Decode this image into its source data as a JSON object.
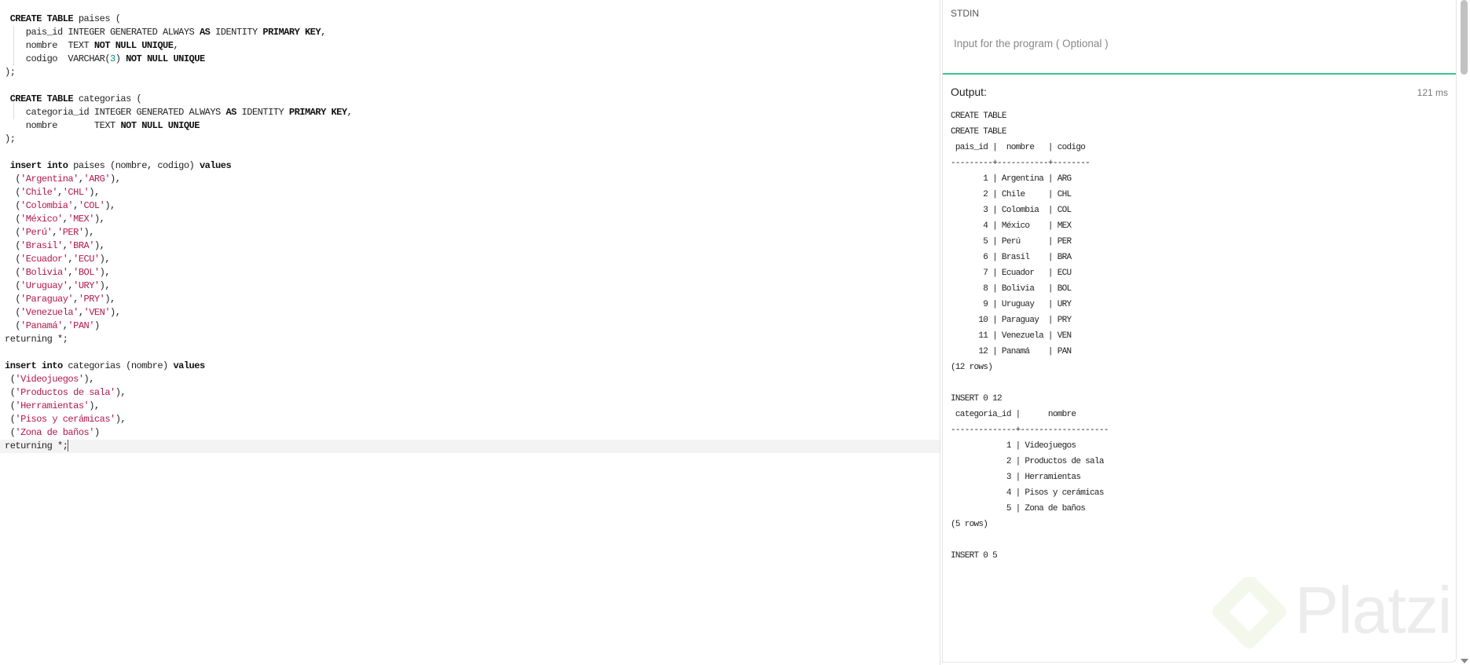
{
  "editor": {
    "lines": [
      [
        [
          " CREATE TABLE",
          "k"
        ],
        [
          " paises (",
          "p"
        ]
      ],
      [
        [
          "    pais_id INTEGER GENERATED ALWAYS ",
          "p"
        ],
        [
          "AS",
          "k"
        ],
        [
          " IDENTITY ",
          "p"
        ],
        [
          "PRIMARY KEY",
          "k"
        ],
        [
          ",",
          "p"
        ]
      ],
      [
        [
          "    nombre  TEXT ",
          "p"
        ],
        [
          "NOT NULL UNIQUE",
          "k"
        ],
        [
          ",",
          "p"
        ]
      ],
      [
        [
          "    codigo  VARCHAR(",
          "p"
        ],
        [
          "3",
          "n"
        ],
        [
          ") ",
          "p"
        ],
        [
          "NOT NULL UNIQUE",
          "k"
        ]
      ],
      [
        [
          ");",
          "p"
        ]
      ],
      [
        [
          "",
          "p"
        ]
      ],
      [
        [
          " CREATE TABLE",
          "k"
        ],
        [
          " categorias (",
          "p"
        ]
      ],
      [
        [
          "    categoria_id INTEGER GENERATED ALWAYS ",
          "p"
        ],
        [
          "AS",
          "k"
        ],
        [
          " IDENTITY ",
          "p"
        ],
        [
          "PRIMARY KEY",
          "k"
        ],
        [
          ",",
          "p"
        ]
      ],
      [
        [
          "    nombre       TEXT ",
          "p"
        ],
        [
          "NOT NULL UNIQUE",
          "k"
        ]
      ],
      [
        [
          ");",
          "p"
        ]
      ],
      [
        [
          "",
          "p"
        ]
      ],
      [
        [
          " insert into",
          "k"
        ],
        [
          " paises (nombre, codigo) ",
          "p"
        ],
        [
          "values",
          "k"
        ]
      ],
      [
        [
          "  (",
          "p"
        ],
        [
          "'Argentina'",
          "s"
        ],
        [
          ",",
          "p"
        ],
        [
          "'ARG'",
          "s"
        ],
        [
          "),",
          "p"
        ]
      ],
      [
        [
          "  (",
          "p"
        ],
        [
          "'Chile'",
          "s"
        ],
        [
          ",",
          "p"
        ],
        [
          "'CHL'",
          "s"
        ],
        [
          "),",
          "p"
        ]
      ],
      [
        [
          "  (",
          "p"
        ],
        [
          "'Colombia'",
          "s"
        ],
        [
          ",",
          "p"
        ],
        [
          "'COL'",
          "s"
        ],
        [
          "),",
          "p"
        ]
      ],
      [
        [
          "  (",
          "p"
        ],
        [
          "'México'",
          "s"
        ],
        [
          ",",
          "p"
        ],
        [
          "'MEX'",
          "s"
        ],
        [
          "),",
          "p"
        ]
      ],
      [
        [
          "  (",
          "p"
        ],
        [
          "'Perú'",
          "s"
        ],
        [
          ",",
          "p"
        ],
        [
          "'PER'",
          "s"
        ],
        [
          "),",
          "p"
        ]
      ],
      [
        [
          "  (",
          "p"
        ],
        [
          "'Brasil'",
          "s"
        ],
        [
          ",",
          "p"
        ],
        [
          "'BRA'",
          "s"
        ],
        [
          "),",
          "p"
        ]
      ],
      [
        [
          "  (",
          "p"
        ],
        [
          "'Ecuador'",
          "s"
        ],
        [
          ",",
          "p"
        ],
        [
          "'ECU'",
          "s"
        ],
        [
          "),",
          "p"
        ]
      ],
      [
        [
          "  (",
          "p"
        ],
        [
          "'Bolivia'",
          "s"
        ],
        [
          ",",
          "p"
        ],
        [
          "'BOL'",
          "s"
        ],
        [
          "),",
          "p"
        ]
      ],
      [
        [
          "  (",
          "p"
        ],
        [
          "'Uruguay'",
          "s"
        ],
        [
          ",",
          "p"
        ],
        [
          "'URY'",
          "s"
        ],
        [
          "),",
          "p"
        ]
      ],
      [
        [
          "  (",
          "p"
        ],
        [
          "'Paraguay'",
          "s"
        ],
        [
          ",",
          "p"
        ],
        [
          "'PRY'",
          "s"
        ],
        [
          "),",
          "p"
        ]
      ],
      [
        [
          "  (",
          "p"
        ],
        [
          "'Venezuela'",
          "s"
        ],
        [
          ",",
          "p"
        ],
        [
          "'VEN'",
          "s"
        ],
        [
          "),",
          "p"
        ]
      ],
      [
        [
          "  (",
          "p"
        ],
        [
          "'Panamá'",
          "s"
        ],
        [
          ",",
          "p"
        ],
        [
          "'PAN'",
          "s"
        ],
        [
          ")",
          "p"
        ]
      ],
      [
        [
          "returning *;",
          "p"
        ]
      ],
      [
        [
          "",
          "p"
        ]
      ],
      [
        [
          "insert into",
          "k"
        ],
        [
          " categorias (nombre) ",
          "p"
        ],
        [
          "values",
          "k"
        ]
      ],
      [
        [
          " (",
          "p"
        ],
        [
          "'Videojuegos'",
          "s"
        ],
        [
          "),",
          "p"
        ]
      ],
      [
        [
          " (",
          "p"
        ],
        [
          "'Productos de sala'",
          "s"
        ],
        [
          "),",
          "p"
        ]
      ],
      [
        [
          " (",
          "p"
        ],
        [
          "'Herramientas'",
          "s"
        ],
        [
          "),",
          "p"
        ]
      ],
      [
        [
          " (",
          "p"
        ],
        [
          "'Pisos y cerámicas'",
          "s"
        ],
        [
          "),",
          "p"
        ]
      ],
      [
        [
          " (",
          "p"
        ],
        [
          "'Zona de baños'",
          "s"
        ],
        [
          ")",
          "p"
        ]
      ],
      [
        [
          "returning *;",
          "p"
        ]
      ]
    ],
    "current_line": 32
  },
  "stdin": {
    "label": "STDIN",
    "placeholder": "Input for the program ( Optional )"
  },
  "output": {
    "label": "Output:",
    "time": "121 ms",
    "lines": [
      "CREATE TABLE",
      "CREATE TABLE",
      " pais_id |  nombre   | codigo",
      "---------+-----------+--------",
      "       1 | Argentina | ARG",
      "       2 | Chile     | CHL",
      "       3 | Colombia  | COL",
      "       4 | México    | MEX",
      "       5 | Perú      | PER",
      "       6 | Brasil    | BRA",
      "       7 | Ecuador   | ECU",
      "       8 | Bolivia   | BOL",
      "       9 | Uruguay   | URY",
      "      10 | Paraguay  | PRY",
      "      11 | Venezuela | VEN",
      "      12 | Panamá    | PAN",
      "(12 rows)",
      "",
      "INSERT 0 12",
      " categoria_id |      nombre",
      "--------------+-------------------",
      "            1 | Videojuegos",
      "            2 | Productos de sala",
      "            3 | Herramientas",
      "            4 | Pisos y cerámicas",
      "            5 | Zona de baños",
      "(5 rows)",
      "",
      "INSERT 0 5"
    ]
  },
  "watermark": {
    "text": "Platzi",
    "color": "#ececec",
    "icon_color": "#f4f8ec"
  },
  "colors": {
    "accent": "#3cc489",
    "string": "#b3164a",
    "number": "#0a8a8a"
  }
}
